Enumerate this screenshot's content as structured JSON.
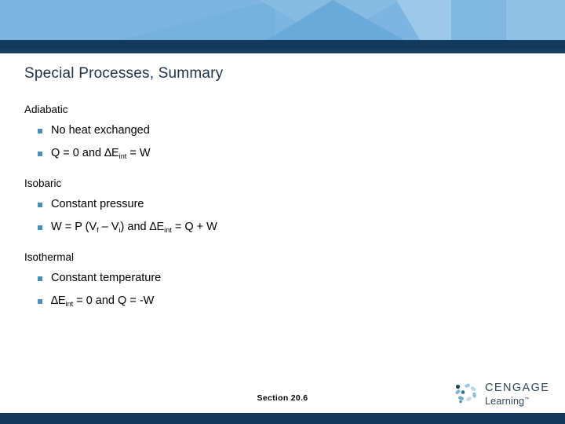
{
  "slide": {
    "title": "Special Processes, Summary",
    "sections": [
      {
        "heading": "Adiabatic",
        "bullets": [
          {
            "parts": [
              {
                "t": "text",
                "v": "No heat exchanged"
              }
            ]
          },
          {
            "parts": [
              {
                "t": "text",
                "v": "Q = 0 and "
              },
              {
                "t": "delta",
                "v": "∆"
              },
              {
                "t": "text",
                "v": "E"
              },
              {
                "t": "sub",
                "v": "int"
              },
              {
                "t": "text",
                "v": " = W"
              }
            ]
          }
        ]
      },
      {
        "heading": "Isobaric",
        "bullets": [
          {
            "parts": [
              {
                "t": "text",
                "v": "Constant pressure"
              }
            ]
          },
          {
            "parts": [
              {
                "t": "text",
                "v": "W = P (V"
              },
              {
                "t": "sub",
                "v": "f"
              },
              {
                "t": "text",
                "v": " – V"
              },
              {
                "t": "sub",
                "v": "i"
              },
              {
                "t": "text",
                "v": ") and "
              },
              {
                "t": "delta",
                "v": "∆"
              },
              {
                "t": "text",
                "v": "E"
              },
              {
                "t": "sub",
                "v": "int"
              },
              {
                "t": "text",
                "v": " = Q + W"
              }
            ]
          }
        ]
      },
      {
        "heading": "Isothermal",
        "bullets": [
          {
            "parts": [
              {
                "t": "text",
                "v": "Constant temperature"
              }
            ]
          },
          {
            "parts": [
              {
                "t": "delta",
                "v": "∆"
              },
              {
                "t": "text",
                "v": "E"
              },
              {
                "t": "sub",
                "v": "int"
              },
              {
                "t": "text",
                "v": " = 0 and Q = -W"
              }
            ]
          }
        ]
      }
    ]
  },
  "footer": {
    "section_label": "Section  20.6",
    "logo": {
      "brand": "CENGAGE",
      "subbrand": "Learning",
      "trademark": "™",
      "mark_icon": "cengage-swirl-icon"
    }
  },
  "theme": {
    "banner_blue": "#7db5e0",
    "navy": "#113a5c",
    "title_color": "#1f3348",
    "bullet_color": "#4a8fb5",
    "logo_color": "#2f4858"
  }
}
